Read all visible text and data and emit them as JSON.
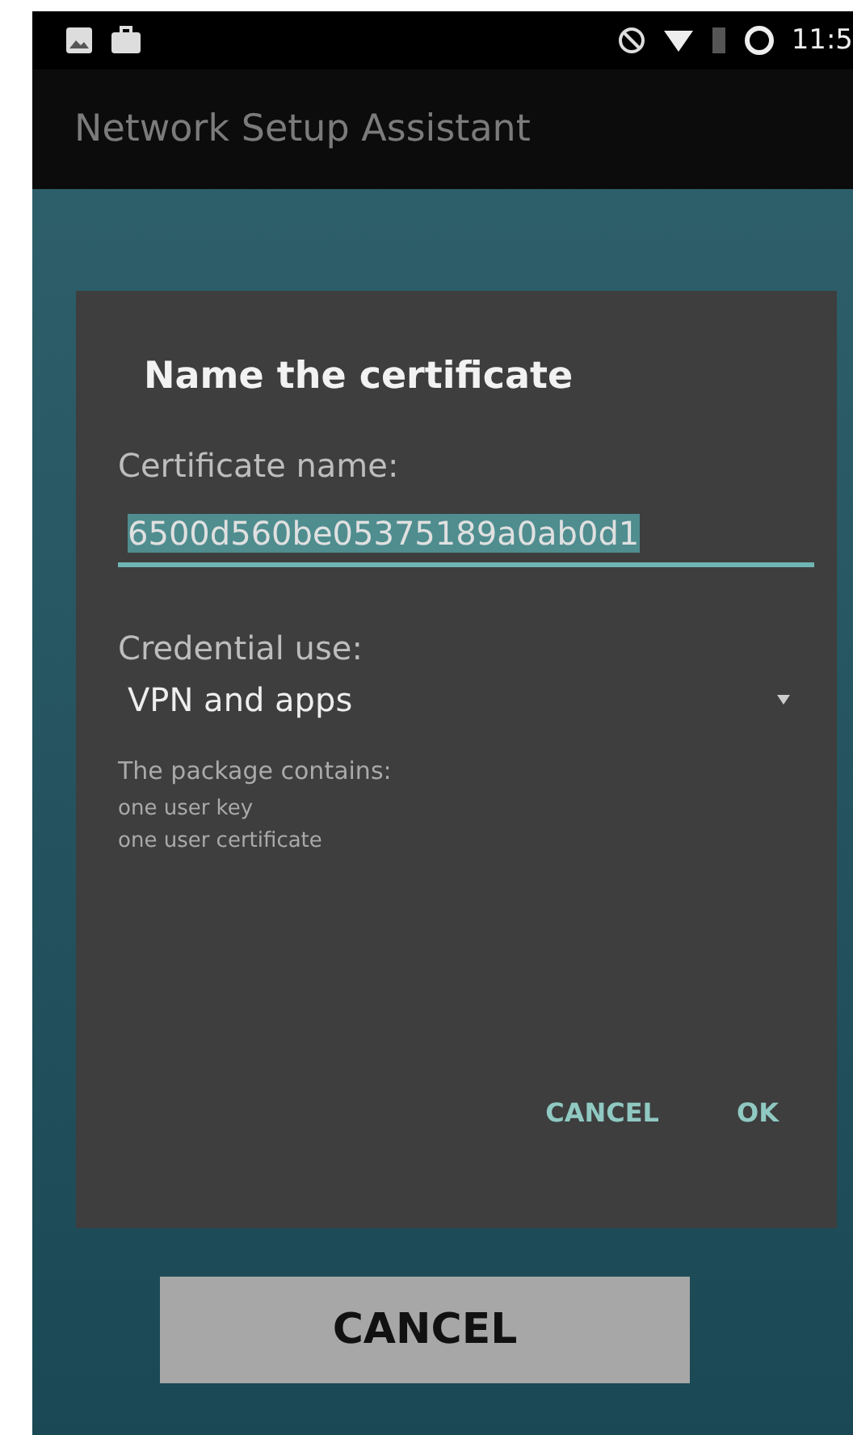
{
  "status_bar": {
    "time": "11:5"
  },
  "app_bar": {
    "title": "Network Setup Assistant"
  },
  "dialog": {
    "title": "Name the certificate",
    "name_label": "Certificate name:",
    "name_field": {
      "value": "6500d560be05375189a0ab0d1",
      "selected": true
    },
    "use_label": "Credential use:",
    "use_dropdown": {
      "value": "VPN and apps"
    },
    "package_lines": [
      "The package contains:",
      "one user key",
      "one user certificate"
    ],
    "buttons": [
      "CANCEL",
      "OK"
    ]
  },
  "bottom_button": "CANCEL"
}
